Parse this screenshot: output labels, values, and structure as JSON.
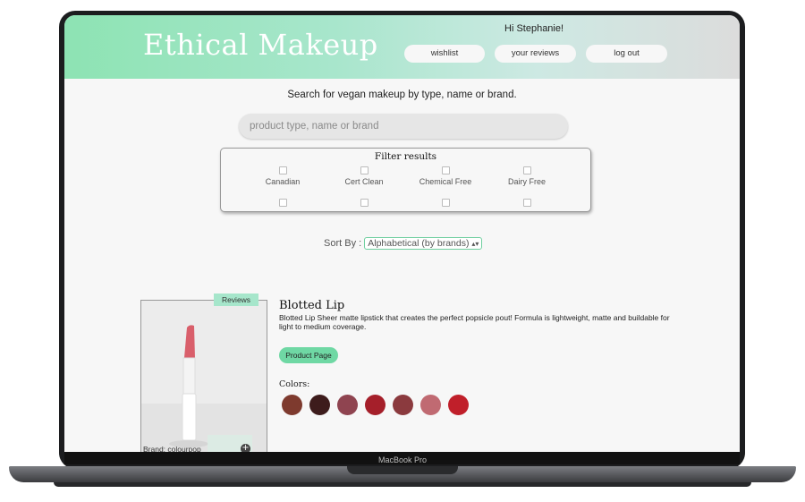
{
  "header": {
    "logo": "Ethical Makeup",
    "greeting": "Hi Stephanie!",
    "nav": [
      {
        "label": "wishlist"
      },
      {
        "label": "your reviews"
      },
      {
        "label": "log out"
      }
    ]
  },
  "search": {
    "instruction": "Search for vegan makeup by type, name or brand.",
    "placeholder": "product type, name or brand"
  },
  "filters": {
    "title": "Filter results",
    "options": [
      "Canadian",
      "Cert Clean",
      "Chemical Free",
      "Dairy Free"
    ]
  },
  "sort": {
    "label": "Sort By :",
    "selected": "Alphabetical (by brands)"
  },
  "product": {
    "reviews_label": "Reviews",
    "brand": "Brand: colourpop",
    "name": "Blotted Lip",
    "description": "Blotted Lip Sheer matte lipstick that creates the perfect popsicle pout! Formula is lightweight, matte and buildable for light to medium coverage.",
    "button": "Product Page",
    "colors_label": "Colors:",
    "colors": [
      "#7e3a2e",
      "#3d1c1c",
      "#8f4450",
      "#a51f2a",
      "#8b3a3e",
      "#c06a72",
      "#c01f2a"
    ]
  },
  "device": {
    "label": "MacBook Pro"
  }
}
